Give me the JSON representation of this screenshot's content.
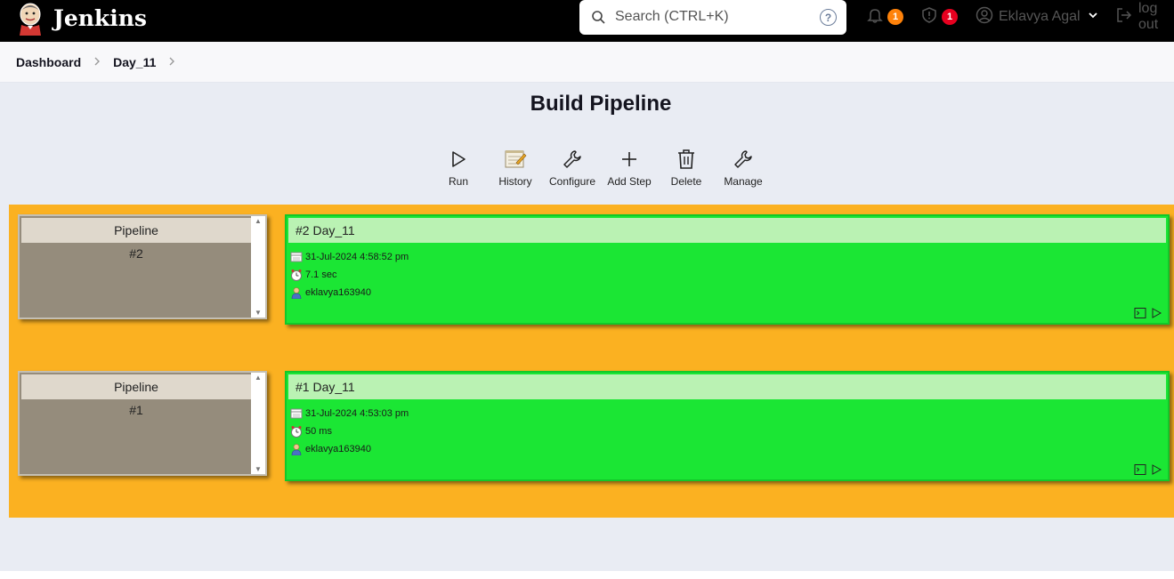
{
  "header": {
    "brand": "Jenkins",
    "search_placeholder": "Search (CTRL+K)",
    "help_glyph": "?",
    "notifications_count": "1",
    "security_count": "1",
    "user_name": "Eklavya Agal",
    "logout_label": "log out"
  },
  "breadcrumb": {
    "dashboard": "Dashboard",
    "job": "Day_11"
  },
  "page": {
    "title": "Build Pipeline"
  },
  "toolbar": {
    "run": "Run",
    "history": "History",
    "configure": "Configure",
    "add_step": "Add Step",
    "delete": "Delete",
    "manage": "Manage"
  },
  "pipelines": [
    {
      "label": "Pipeline",
      "number": "#2",
      "build_title": "#2 Day_11",
      "date": "31-Jul-2024 4:58:52 pm",
      "duration": "7.1 sec",
      "user": "eklavya163940"
    },
    {
      "label": "Pipeline",
      "number": "#1",
      "build_title": "#1 Day_11",
      "date": "31-Jul-2024 4:53:03 pm",
      "duration": "50 ms",
      "user": "eklavya163940"
    }
  ],
  "colors": {
    "header_bg": "#000000",
    "stage_bg": "#fbb121",
    "success_green": "#1be634",
    "success_header": "#baf2b3",
    "pipeline_box": "#958c7c",
    "badge_orange": "#fe820a",
    "badge_red": "#e6001f"
  }
}
